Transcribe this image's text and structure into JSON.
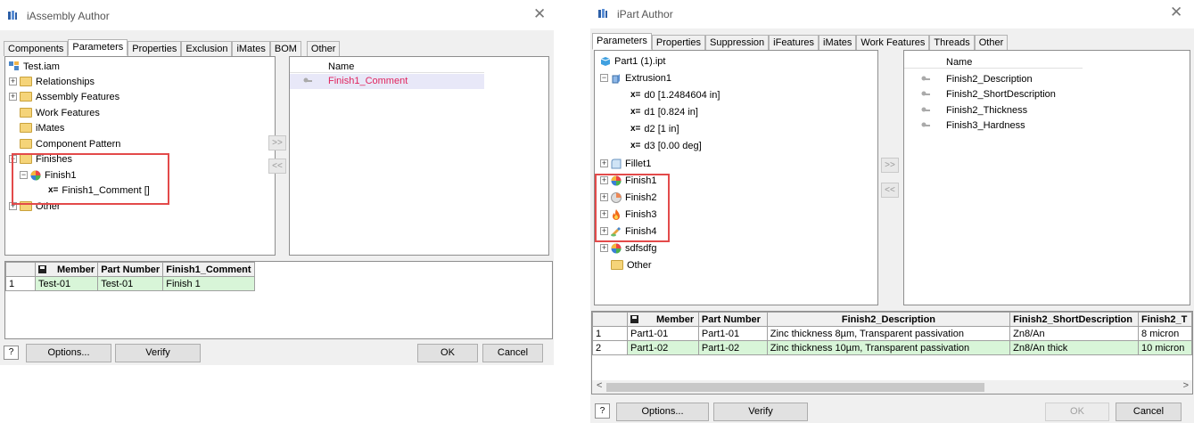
{
  "left": {
    "title": "iAssembly Author",
    "tabs": [
      "Components",
      "Parameters",
      "Properties",
      "Exclusion",
      "iMates",
      "BOM",
      "Other"
    ],
    "active_tab": "Parameters",
    "tree": {
      "root": "Test.iam",
      "items": [
        "Relationships",
        "Assembly Features",
        "Work Features",
        "iMates",
        "Component Pattern",
        "Finishes",
        "Finish1",
        "Finish1_Comment []",
        "Other"
      ],
      "x_symbol": "x="
    },
    "move_right": ">>",
    "move_left": "<<",
    "selected_header": "Name",
    "selected": [
      "Finish1_Comment"
    ],
    "table": {
      "headers": [
        "Member",
        "Part Number",
        "Finish1_Comment"
      ],
      "rows": [
        [
          "1",
          "Test-01",
          "Test-01",
          "Finish 1"
        ]
      ]
    },
    "help": "?",
    "buttons": {
      "options": "Options...",
      "verify": "Verify",
      "ok": "OK",
      "cancel": "Cancel"
    }
  },
  "right": {
    "title": "iPart Author",
    "tabs": [
      "Parameters",
      "Properties",
      "Suppression",
      "iFeatures",
      "iMates",
      "Work Features",
      "Threads",
      "Other"
    ],
    "active_tab": "Parameters",
    "tree": {
      "root": "Part1 (1).ipt",
      "extrusion": "Extrusion1",
      "params": [
        "d0 [1.2484604 in]",
        "d1 [0.824 in]",
        "d2 [1 in]",
        "d3 [0.00 deg]"
      ],
      "x_symbol": "x=",
      "fillet": "Fillet1",
      "finishes": [
        "Finish1",
        "Finish2",
        "Finish3",
        "Finish4"
      ],
      "extra": "sdfsdfg",
      "other": "Other"
    },
    "move_right": ">>",
    "move_left": "<<",
    "selected_header": "Name",
    "selected": [
      "Finish2_Description",
      "Finish2_ShortDescription",
      "Finish2_Thickness",
      "Finish3_Hardness"
    ],
    "table": {
      "headers": [
        "Member",
        "Part Number",
        "Finish2_Description",
        "Finish2_ShortDescription",
        "Finish2_T"
      ],
      "rows": [
        [
          "1",
          "Part1-01",
          "Part1-01",
          "Zinc thickness 8µm, Transparent passivation",
          "Zn8/An",
          "8 micron"
        ],
        [
          "2",
          "Part1-02",
          "Part1-02",
          "Zinc thickness 10µm, Transparent passivation",
          "Zn8/An thick",
          "10 micron"
        ]
      ]
    },
    "help": "?",
    "scroll_left": "<",
    "scroll_right": ">",
    "buttons": {
      "options": "Options...",
      "verify": "Verify",
      "ok": "OK",
      "cancel": "Cancel"
    }
  }
}
